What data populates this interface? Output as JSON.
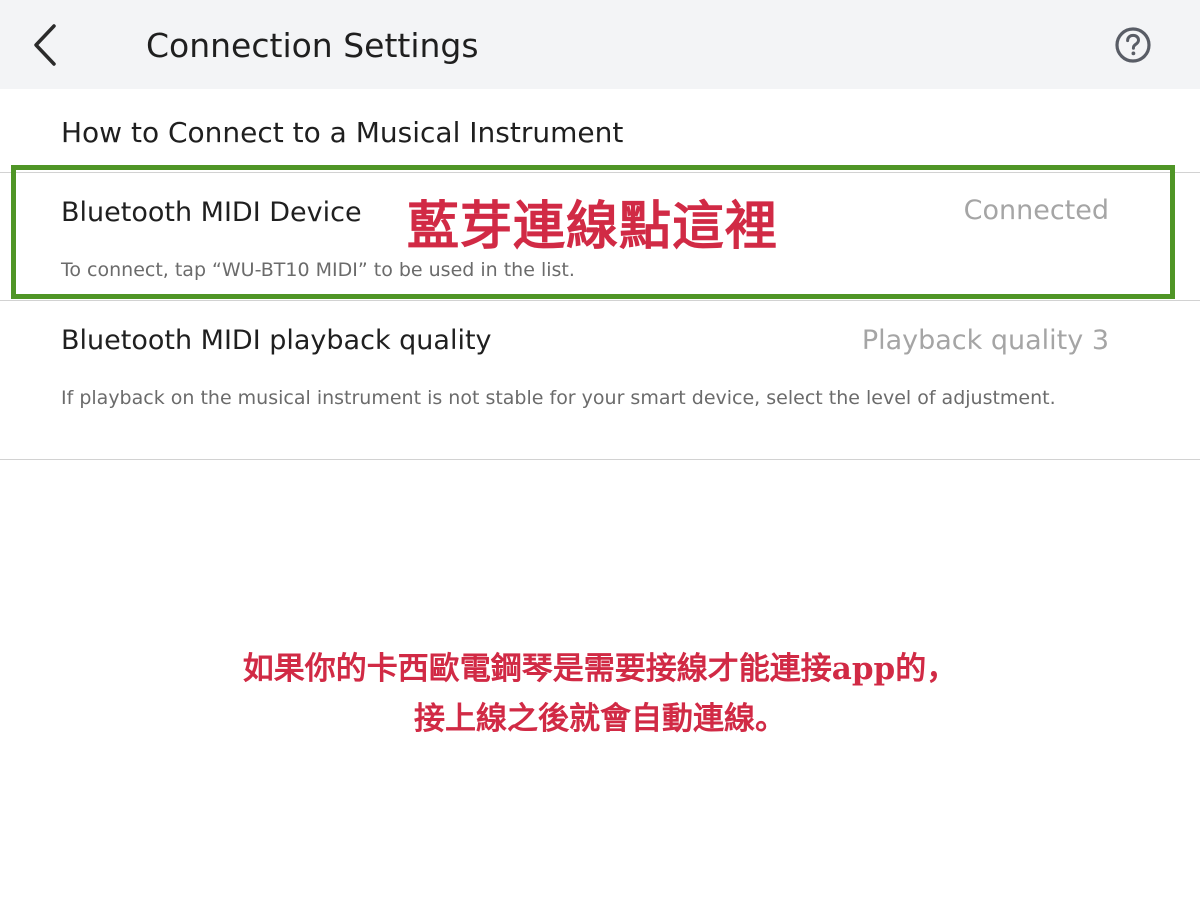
{
  "navbar": {
    "back_icon": "chevron-left-icon",
    "title": "Connection Settings",
    "help_icon": "question-circle-icon"
  },
  "section": {
    "header": "How to Connect to a Musical Instrument"
  },
  "rows": {
    "bluetooth_device": {
      "title": "Bluetooth MIDI Device",
      "value": "Connected",
      "description": "To connect, tap “WU-BT10 MIDI” to be used in the list."
    },
    "playback_quality": {
      "title": "Bluetooth MIDI playback quality",
      "value": "Playback quality 3",
      "description": "If playback on the musical instrument is not stable for your smart device, select the level of adjustment."
    }
  },
  "annotations": {
    "highlight_label": "藍芽連線點這裡",
    "note_line1": "如果你的卡西歐電鋼琴是需要接線才能連接app的，",
    "note_line2": "接上線之後就會自動連線。"
  },
  "colors": {
    "navbar_bg": "#f3f4f6",
    "annotation_red": "#d12a45",
    "highlight_green": "#4f9526",
    "value_gray": "#a5a5a5"
  }
}
